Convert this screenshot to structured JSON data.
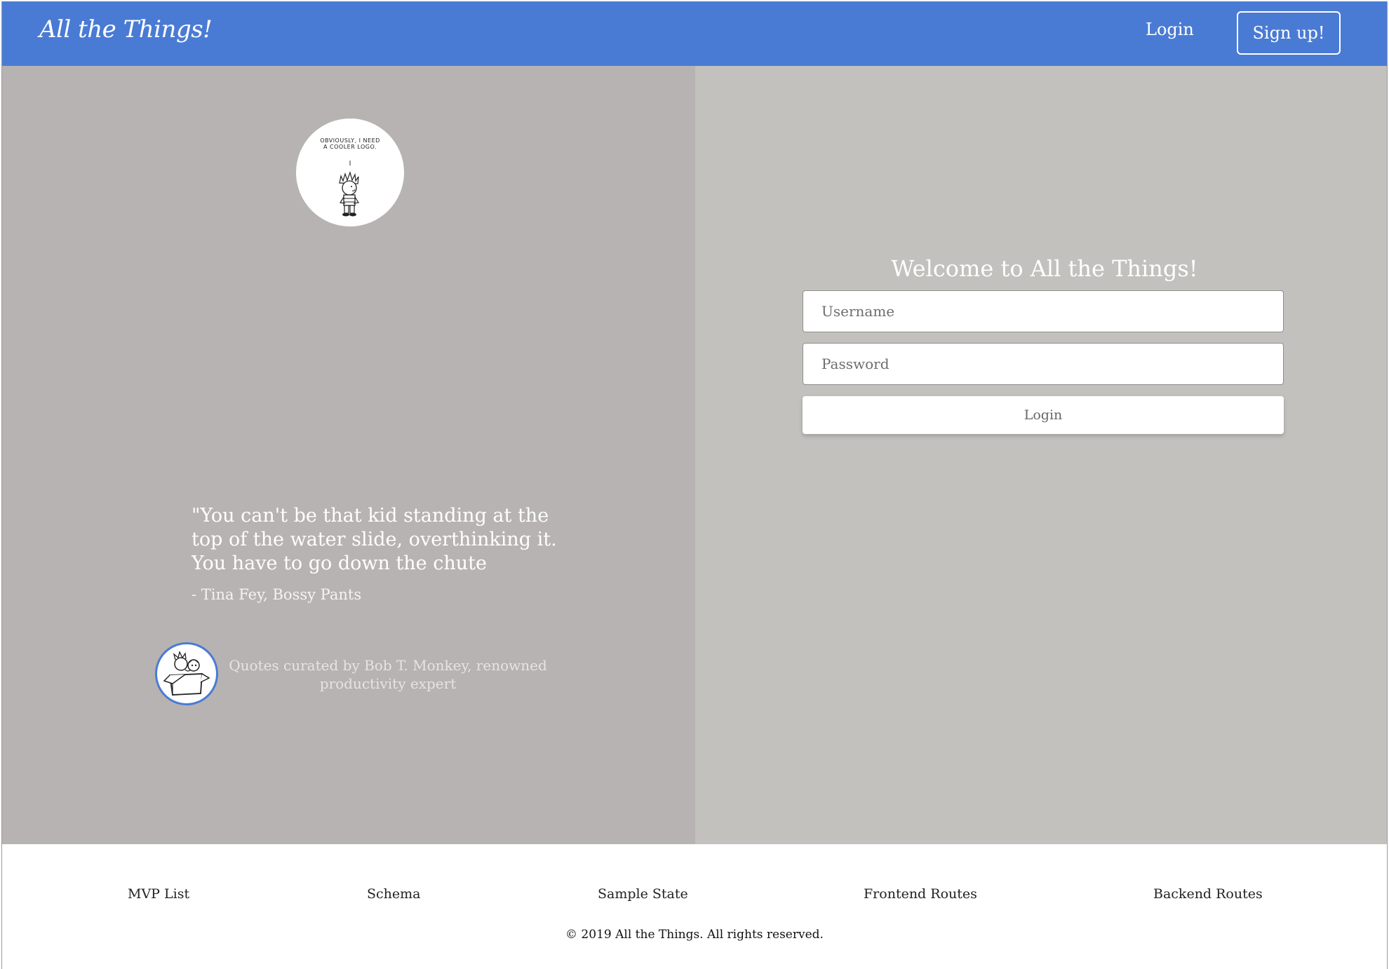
{
  "header": {
    "brand": "All the Things!",
    "login_label": "Login",
    "signup_label": "Sign up!",
    "background_color": "#4a7bd4"
  },
  "hero": {
    "logo_caption": "OBVIOUSLY, I NEED\nA COOLER LOGO.",
    "quote": "\"You can't be that kid standing at the top of the water slide, overthinking it. You have to go down the chute",
    "quote_author": "- Tina Fey, Bossy Pants",
    "curator_text": "Quotes curated by Bob T. Monkey, renowned productivity expert",
    "background_color": "#b7b3b2"
  },
  "login_form": {
    "title": "Welcome to All the Things!",
    "username_placeholder": "Username",
    "username_value": "",
    "password_placeholder": "Password",
    "password_value": "",
    "submit_label": "Login",
    "background_color": "#c2c1bd"
  },
  "footer": {
    "links": [
      "MVP List",
      "Schema",
      "Sample State",
      "Frontend Routes",
      "Backend Routes"
    ],
    "copyright": "© 2019 All the Things. All rights reserved."
  }
}
